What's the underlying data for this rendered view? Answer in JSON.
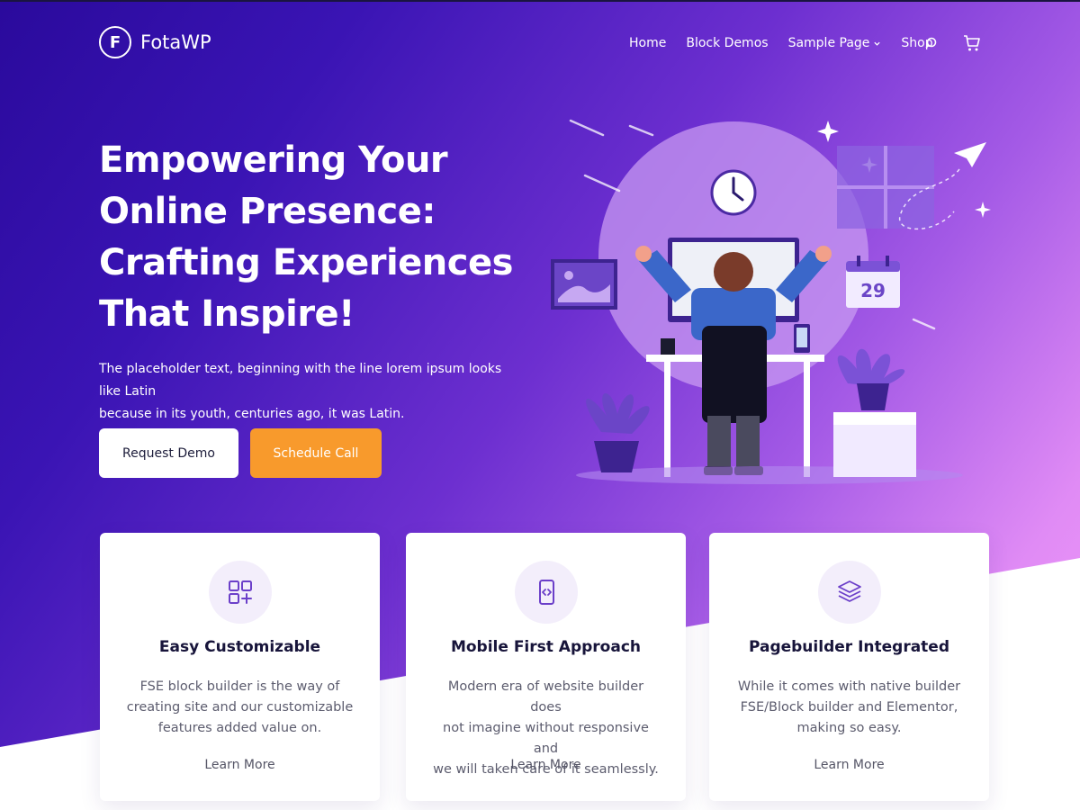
{
  "brand": {
    "name": "FotaWP",
    "logo_letter": "F",
    "icon": "fotawp-logo-icon"
  },
  "nav": {
    "items": [
      {
        "label": "Home"
      },
      {
        "label": "Block Demos"
      },
      {
        "label": "Sample Page",
        "has_dropdown": true
      },
      {
        "label": "Shop"
      }
    ],
    "icons": [
      "search-icon",
      "cart-icon"
    ]
  },
  "hero": {
    "headline_lines": [
      "Empowering Your",
      "Online Presence:",
      "Crafting Experiences",
      "That Inspire!"
    ],
    "description_lines": [
      "The placeholder text, beginning with the line lorem ipsum looks like Latin",
      "because in its youth, centuries ago, it was Latin."
    ],
    "primary_button": "Request Demo",
    "secondary_button": "Schedule Call",
    "illustration": {
      "calendar_day": "29"
    }
  },
  "features": [
    {
      "icon": "grid-plus-icon",
      "title": "Easy Customizable",
      "text_lines": [
        "FSE block builder is the way of",
        "creating site and our customizable",
        "features added value on."
      ],
      "link": "Learn More"
    },
    {
      "icon": "mobile-code-icon",
      "title": "Mobile First Approach",
      "text_lines": [
        "Modern era of website builder does",
        "not imagine without responsive and",
        "we will taken care of it seamlessly."
      ],
      "link": "Learn More"
    },
    {
      "icon": "layers-icon",
      "title": "Pagebuilder Integrated",
      "text_lines": [
        "While it comes with native builder",
        "FSE/Block builder and Elementor,",
        "making so easy."
      ],
      "link": "Learn More"
    }
  ],
  "colors": {
    "hero_start": "#2a0a9c",
    "hero_end": "#f59bf8",
    "accent_orange": "#f89a2c",
    "icon_purple": "#6b3fc9",
    "card_icon_bg": "#f3eefb"
  }
}
